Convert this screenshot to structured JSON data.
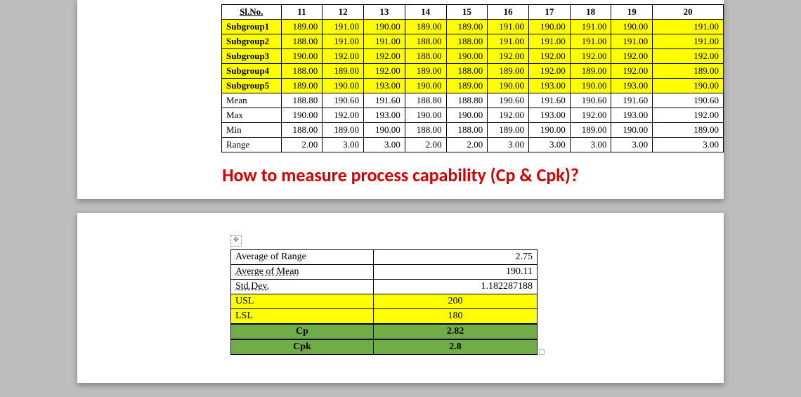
{
  "title": "How to measure process capability (Cp & Cpk)?",
  "data_table": {
    "header": [
      "Sl.No.",
      "11",
      "12",
      "13",
      "14",
      "15",
      "16",
      "17",
      "18",
      "19",
      "20"
    ],
    "subgroup_rows": [
      {
        "label": "Subgroup1",
        "vals": [
          "189.00",
          "191.00",
          "190.00",
          "189.00",
          "189.00",
          "191.00",
          "190.00",
          "191.00",
          "190.00",
          "191.00"
        ]
      },
      {
        "label": "Subgroup2",
        "vals": [
          "188.00",
          "191.00",
          "191.00",
          "188.00",
          "188.00",
          "191.00",
          "191.00",
          "191.00",
          "191.00",
          "191.00"
        ]
      },
      {
        "label": "Subgroup3",
        "vals": [
          "190.00",
          "192.00",
          "192.00",
          "188.00",
          "190.00",
          "192.00",
          "192.00",
          "192.00",
          "192.00",
          "192.00"
        ]
      },
      {
        "label": "Subgroup4",
        "vals": [
          "188.00",
          "189.00",
          "192.00",
          "189.00",
          "188.00",
          "189.00",
          "192.00",
          "189.00",
          "192.00",
          "189.00"
        ]
      },
      {
        "label": "Subgroup5",
        "vals": [
          "189.00",
          "190.00",
          "193.00",
          "190.00",
          "189.00",
          "190.00",
          "193.00",
          "190.00",
          "193.00",
          "190.00"
        ]
      }
    ],
    "stat_rows": [
      {
        "label": "Mean",
        "vals": [
          "188.80",
          "190.60",
          "191.60",
          "188.80",
          "188.80",
          "190.60",
          "191.60",
          "190.60",
          "191.60",
          "190.60"
        ]
      },
      {
        "label": "Max",
        "vals": [
          "190.00",
          "192.00",
          "193.00",
          "190.00",
          "190.00",
          "192.00",
          "193.00",
          "192.00",
          "193.00",
          "192.00"
        ]
      },
      {
        "label": "Min",
        "vals": [
          "188.00",
          "189.00",
          "190.00",
          "188.00",
          "188.00",
          "189.00",
          "190.00",
          "189.00",
          "190.00",
          "189.00"
        ]
      },
      {
        "label": "Range",
        "vals": [
          "2.00",
          "3.00",
          "3.00",
          "2.00",
          "2.00",
          "3.00",
          "3.00",
          "3.00",
          "3.00",
          "3.00"
        ]
      }
    ]
  },
  "results": {
    "rows": [
      {
        "label": "Average of Range",
        "value": "2.75",
        "class": "",
        "align": "right"
      },
      {
        "label": "Averge of Mean",
        "value": "190.11",
        "class": "",
        "align": "right",
        "ud": true
      },
      {
        "label": "Std.Dev.",
        "value": "1.182287188",
        "class": "",
        "align": "right",
        "ud_lbl": true
      },
      {
        "label": "USL",
        "value": "200",
        "class": "yellow",
        "align": "center"
      },
      {
        "label": "LSL",
        "value": "180",
        "class": "yellow",
        "align": "center"
      },
      {
        "label": "Cp",
        "value": "2.82",
        "class": "green",
        "align": "center"
      },
      {
        "label": "Cpk",
        "value": "2.8",
        "class": "green",
        "align": "center"
      }
    ]
  }
}
